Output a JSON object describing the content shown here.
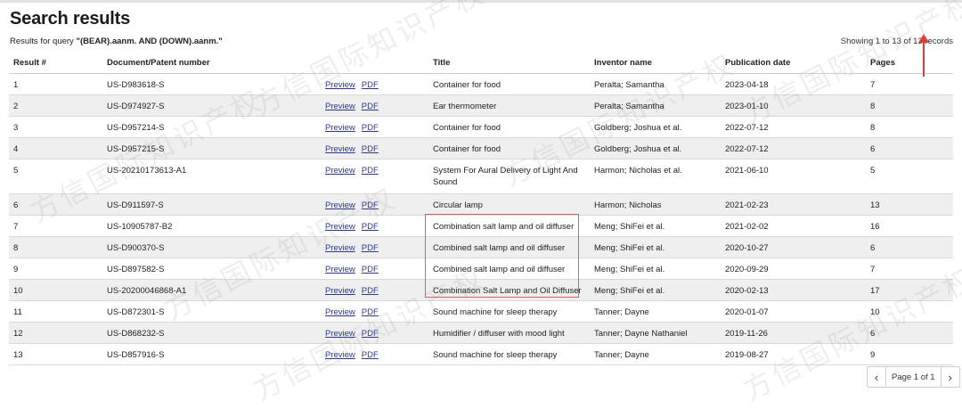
{
  "page_title": "Search results",
  "query": {
    "prefix": "Results for query ",
    "value": "\"(BEAR).aanm. AND (DOWN).aanm.\""
  },
  "showing": "Showing 1 to 13 of 13 records",
  "columns": {
    "result": "Result #",
    "document": "Document/Patent number",
    "links": "",
    "title": "Title",
    "inventor": "Inventor name",
    "pubdate": "Publication date",
    "pages": "Pages"
  },
  "link_labels": {
    "preview": "Preview",
    "pdf": "PDF"
  },
  "rows": [
    {
      "num": "1",
      "doc": "US-D983618-S",
      "title": "Container for food",
      "inventor": "Peralta; Samantha",
      "date": "2023-04-18",
      "pages": "7"
    },
    {
      "num": "2",
      "doc": "US-D974927-S",
      "title": "Ear thermometer",
      "inventor": "Peralta; Samantha",
      "date": "2023-01-10",
      "pages": "8"
    },
    {
      "num": "3",
      "doc": "US-D957214-S",
      "title": "Container for food",
      "inventor": "Goldberg; Joshua et al.",
      "date": "2022-07-12",
      "pages": "8"
    },
    {
      "num": "4",
      "doc": "US-D957215-S",
      "title": "Container for food",
      "inventor": "Goldberg; Joshua et al.",
      "date": "2022-07-12",
      "pages": "6"
    },
    {
      "num": "5",
      "doc": "US-20210173613-A1",
      "title": "System For Aural Delivery of Light And Sound",
      "inventor": "Harmon; Nicholas et al.",
      "date": "2021-06-10",
      "pages": "5"
    },
    {
      "num": "6",
      "doc": "US-D911597-S",
      "title": "Circular lamp",
      "inventor": "Harmon; Nicholas",
      "date": "2021-02-23",
      "pages": "13"
    },
    {
      "num": "7",
      "doc": "US-10905787-B2",
      "title": "Combination salt lamp and oil diffuser",
      "inventor": "Meng; ShiFei et al.",
      "date": "2021-02-02",
      "pages": "16"
    },
    {
      "num": "8",
      "doc": "US-D900370-S",
      "title": "Combined salt lamp and oil diffuser",
      "inventor": "Meng; ShiFei et al.",
      "date": "2020-10-27",
      "pages": "6"
    },
    {
      "num": "9",
      "doc": "US-D897582-S",
      "title": "Combined salt lamp and oil diffuser",
      "inventor": "Meng; ShiFei et al.",
      "date": "2020-09-29",
      "pages": "7"
    },
    {
      "num": "10",
      "doc": "US-20200046868-A1",
      "title": "Combination Salt Lamp and Oil Diffuser",
      "inventor": "Meng; ShiFei et al.",
      "date": "2020-02-13",
      "pages": "17"
    },
    {
      "num": "11",
      "doc": "US-D872301-S",
      "title": "Sound machine for sleep therapy",
      "inventor": "Tanner; Dayne",
      "date": "2020-01-07",
      "pages": "10"
    },
    {
      "num": "12",
      "doc": "US-D868232-S",
      "title": "Humidifier / diffuser with mood light",
      "inventor": "Tanner; Dayne Nathaniel",
      "date": "2019-11-26",
      "pages": "6"
    },
    {
      "num": "13",
      "doc": "US-D857916-S",
      "title": "Sound machine for sleep therapy",
      "inventor": "Tanner; Dayne",
      "date": "2019-08-27",
      "pages": "9"
    }
  ],
  "pagination": {
    "label": "Page 1 of 1",
    "prev_icon": "‹",
    "next_icon": "›"
  },
  "watermark": "方信国际知识产权",
  "colors": {
    "link": "#2c3a8c",
    "highlight_box": "#d96060",
    "arrow": "#e13b3b",
    "row_shade": "#efefef"
  }
}
